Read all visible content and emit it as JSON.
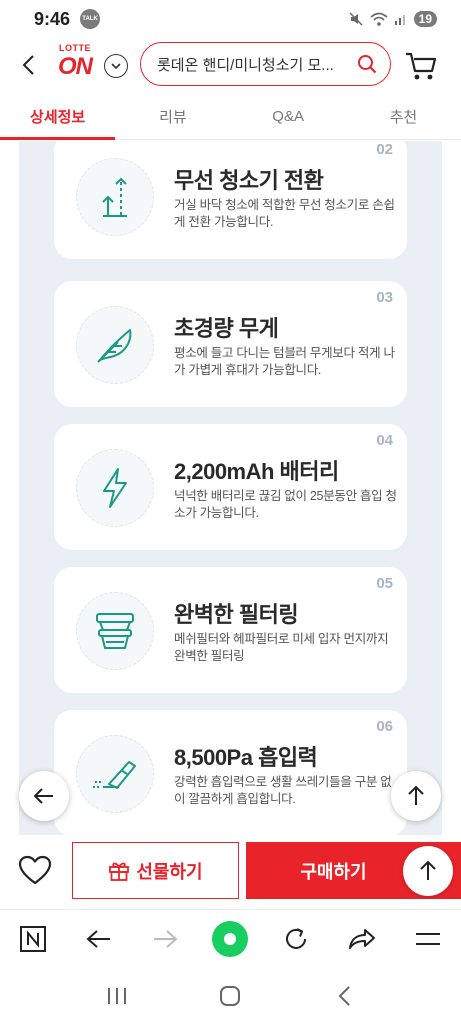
{
  "status_bar": {
    "time": "9:46",
    "talk_badge": "TALK",
    "battery": "19"
  },
  "header": {
    "logo_top": "LOTTE",
    "logo_main": "ON",
    "search_value": "롯데온 핸디/미니청소기 모..."
  },
  "tabs": [
    {
      "label": "상세정보",
      "active": true
    },
    {
      "label": "리뷰",
      "active": false
    },
    {
      "label": "Q&A",
      "active": false
    },
    {
      "label": "추천",
      "active": false
    }
  ],
  "features": [
    {
      "num": "02",
      "title": "무선 청소기 전환",
      "desc": "거실 바닥 청소에 적합한 무선 청소기로 손쉽게 전환 가능합니다.",
      "icon": "convert-arrows-icon"
    },
    {
      "num": "03",
      "title": "초경량 무게",
      "desc": "평소에 들고 다니는 텀블러 무게보다 적게 나가 가볍게 휴대가 가능합니다.",
      "icon": "feather-icon"
    },
    {
      "num": "04",
      "title": "2,200mAh 배터리",
      "desc": "넉넉한 배터리로 끊김 없이 25분동안 흡입 청소가 가능합니다.",
      "icon": "lightning-icon"
    },
    {
      "num": "05",
      "title": "완벽한 필터링",
      "desc": "메쉬필터와 헤파필터로 미세 입자 먼지까지 완벽한 필터링",
      "icon": "filter-icon"
    },
    {
      "num": "06",
      "title": "8,500Pa 흡입력",
      "desc": "강력한 흡입력으로 생활 쓰레기들을 구분 없이 깔끔하게 흡입합니다.",
      "icon": "vacuum-icon"
    }
  ],
  "buy_bar": {
    "gift_label": "선물하기",
    "purchase_label": "구매하기"
  },
  "colors": {
    "accent": "#e8232a",
    "icon_teal": "#1a9a84"
  }
}
